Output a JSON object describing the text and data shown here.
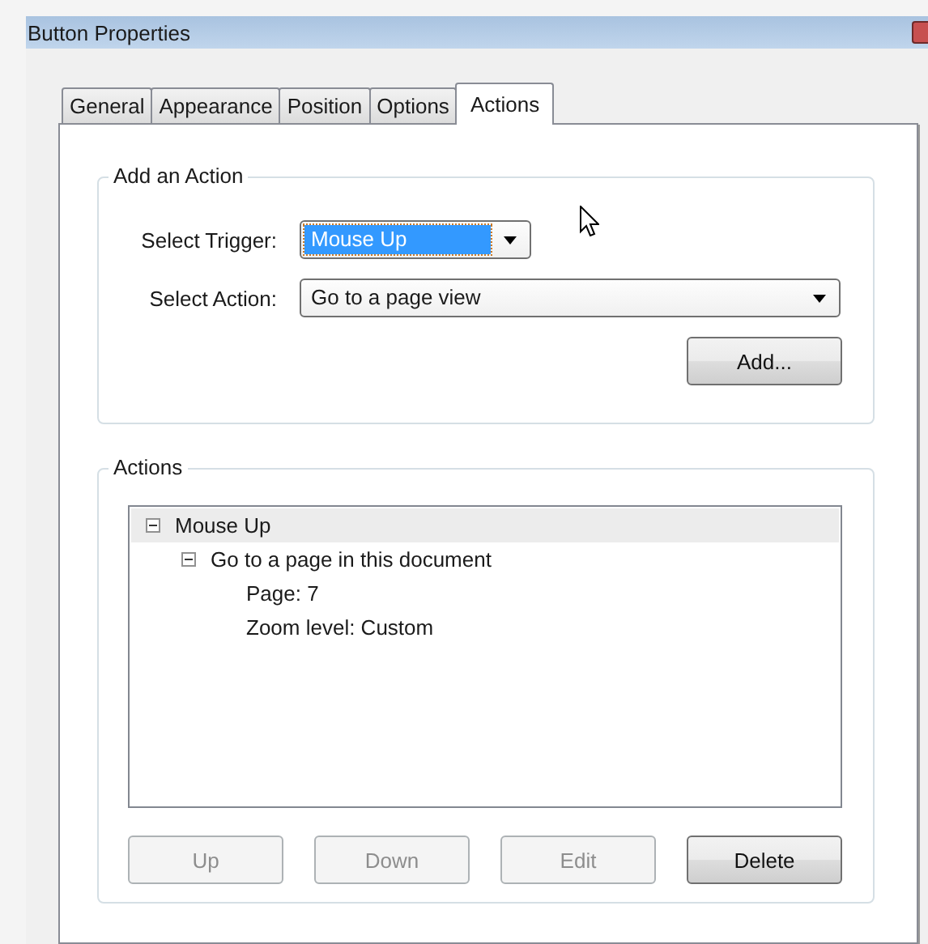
{
  "window": {
    "title": "Button Properties"
  },
  "tabs": [
    {
      "label": "General",
      "selected": false
    },
    {
      "label": "Appearance",
      "selected": false
    },
    {
      "label": "Position",
      "selected": false
    },
    {
      "label": "Options",
      "selected": false
    },
    {
      "label": "Actions",
      "selected": true
    }
  ],
  "add_action": {
    "title": "Add an Action",
    "trigger": {
      "label": "Select Trigger:",
      "value": "Mouse Up",
      "focused": true
    },
    "action": {
      "label": "Select Action:",
      "value": "Go to a page view",
      "focused": false
    },
    "add_button": {
      "label": "Add...",
      "disabled": false
    }
  },
  "actions": {
    "title": "Actions",
    "tree": [
      {
        "label": "Mouse Up",
        "selected": true,
        "expanded": true,
        "children": [
          {
            "label": "Go to a page in this document",
            "selected": false,
            "expanded": true,
            "children": [
              {
                "label": "Page: 7",
                "selected": false
              },
              {
                "label": "Zoom level: Custom",
                "selected": false
              }
            ]
          }
        ]
      }
    ],
    "buttons": [
      {
        "label": "Up",
        "disabled": true
      },
      {
        "label": "Down",
        "disabled": true
      },
      {
        "label": "Edit",
        "disabled": true
      },
      {
        "label": "Delete",
        "disabled": false
      }
    ]
  }
}
